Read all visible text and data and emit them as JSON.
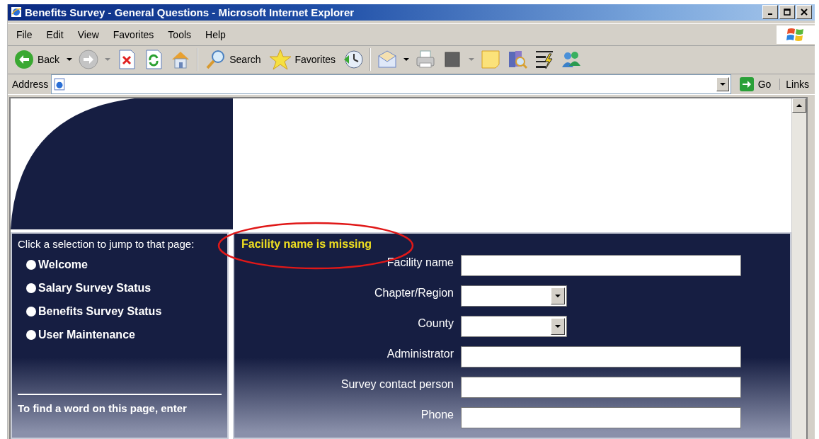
{
  "window": {
    "title": "Benefits Survey - General Questions - Microsoft Internet Explorer"
  },
  "menu": [
    {
      "label": "File"
    },
    {
      "label": "Edit"
    },
    {
      "label": "View"
    },
    {
      "label": "Favorites"
    },
    {
      "label": "Tools"
    },
    {
      "label": "Help"
    }
  ],
  "toolbar": {
    "back": "Back",
    "search": "Search",
    "favorites": "Favorites"
  },
  "address_bar": {
    "label": "Address",
    "go": "Go",
    "links": "Links"
  },
  "sidebar": {
    "heading": "Click a selection to jump to that page:",
    "items": [
      {
        "label": "Welcome"
      },
      {
        "label": "Salary Survey Status"
      },
      {
        "label": "Benefits Survey Status"
      },
      {
        "label": "User Maintenance"
      }
    ],
    "footer": "To find a word on this page, enter"
  },
  "form": {
    "error": "Facility name is missing",
    "error_highlighted": true,
    "fields": [
      {
        "label": "Facility name",
        "kind": "text"
      },
      {
        "label": "Chapter/Region",
        "kind": "select"
      },
      {
        "label": "County",
        "kind": "select"
      },
      {
        "label": "Administrator",
        "kind": "text"
      },
      {
        "label": "Survey contact person",
        "kind": "text"
      },
      {
        "label": "Phone",
        "kind": "text"
      }
    ]
  }
}
